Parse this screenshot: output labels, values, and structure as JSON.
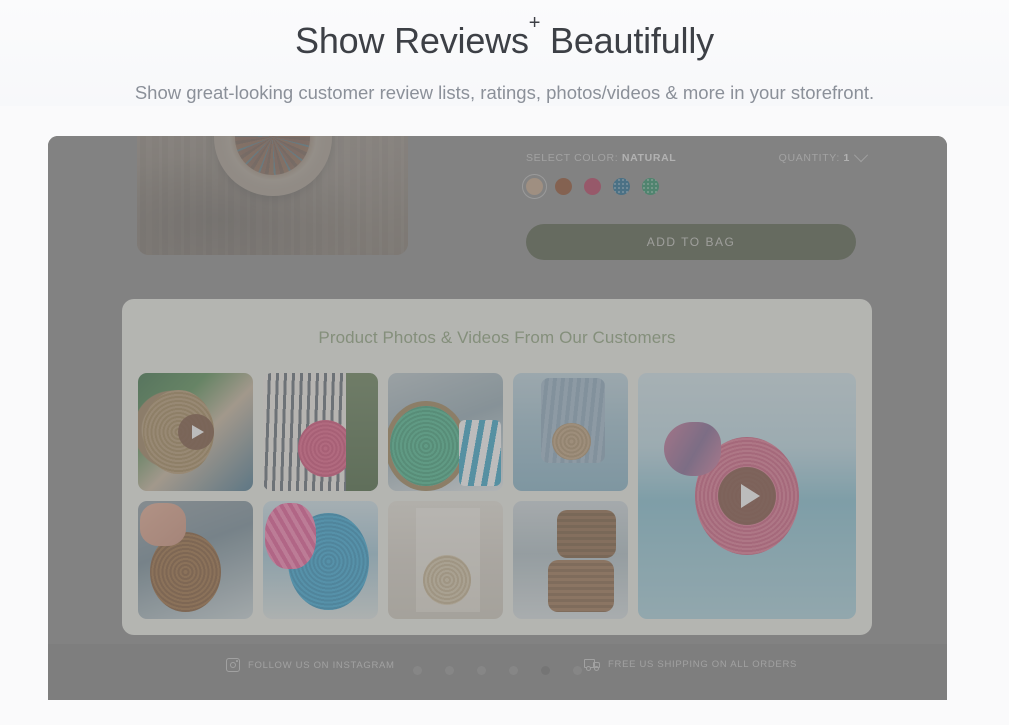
{
  "header": {
    "title_pre": "Show Reviews",
    "title_sup": "+",
    "title_post": " Beautifully",
    "subtitle": "Show great-looking customer review lists, ratings, photos/videos & more in your storefront."
  },
  "product": {
    "color_label": "SELECT COLOR: ",
    "color_value": "NATURAL",
    "quantity_label": "QUANTITY: ",
    "quantity_value": "1",
    "add_to_bag_label": "ADD TO BAG",
    "add_to_bag_color": "#4c573f",
    "swatches": [
      {
        "name": "natural",
        "hex": "#c2a184",
        "selected": true,
        "textured": false
      },
      {
        "name": "brown",
        "hex": "#8a4420",
        "selected": false,
        "textured": false
      },
      {
        "name": "magenta",
        "hex": "#b13155",
        "selected": false,
        "textured": false
      },
      {
        "name": "blue",
        "hex": "#14628c",
        "selected": false,
        "textured": true
      },
      {
        "name": "green",
        "hex": "#1f8a5e",
        "selected": false,
        "textured": true
      }
    ]
  },
  "ugc": {
    "title": "Product Photos & Videos From Our Customers",
    "title_color": "#8ba178",
    "card_color": "#eff0e9",
    "tiles": [
      {
        "name": "rattan-bag-hands",
        "art": "ph-rattan-hands",
        "video": true
      },
      {
        "name": "pink-bag-striped-dress",
        "art": "ph-pink-stripe",
        "video": false
      },
      {
        "name": "green-bag-striped-pillow",
        "art": "ph-green-bag",
        "video": false
      },
      {
        "name": "denim-dress-beach-bag",
        "art": "ph-denim",
        "video": false
      },
      {
        "name": "pink-bag-ocean-video",
        "art": "ph-beach-video",
        "video": true,
        "big": true
      },
      {
        "name": "brown-bag-sandals",
        "art": "ph-brown-bag",
        "video": false
      },
      {
        "name": "blue-bag-pink-scarf",
        "art": "ph-blue-bag",
        "video": false
      },
      {
        "name": "cream-bag-white-dress",
        "art": "ph-cream-bag",
        "video": false
      },
      {
        "name": "stacked-rattan-bags",
        "art": "ph-stack",
        "video": false
      }
    ]
  },
  "footer": {
    "instagram_label": "FOLLOW US ON INSTAGRAM",
    "shipping_label": "FREE US SHIPPING ON ALL ORDERS",
    "carousel_dots": 6,
    "carousel_active_index": 4
  }
}
